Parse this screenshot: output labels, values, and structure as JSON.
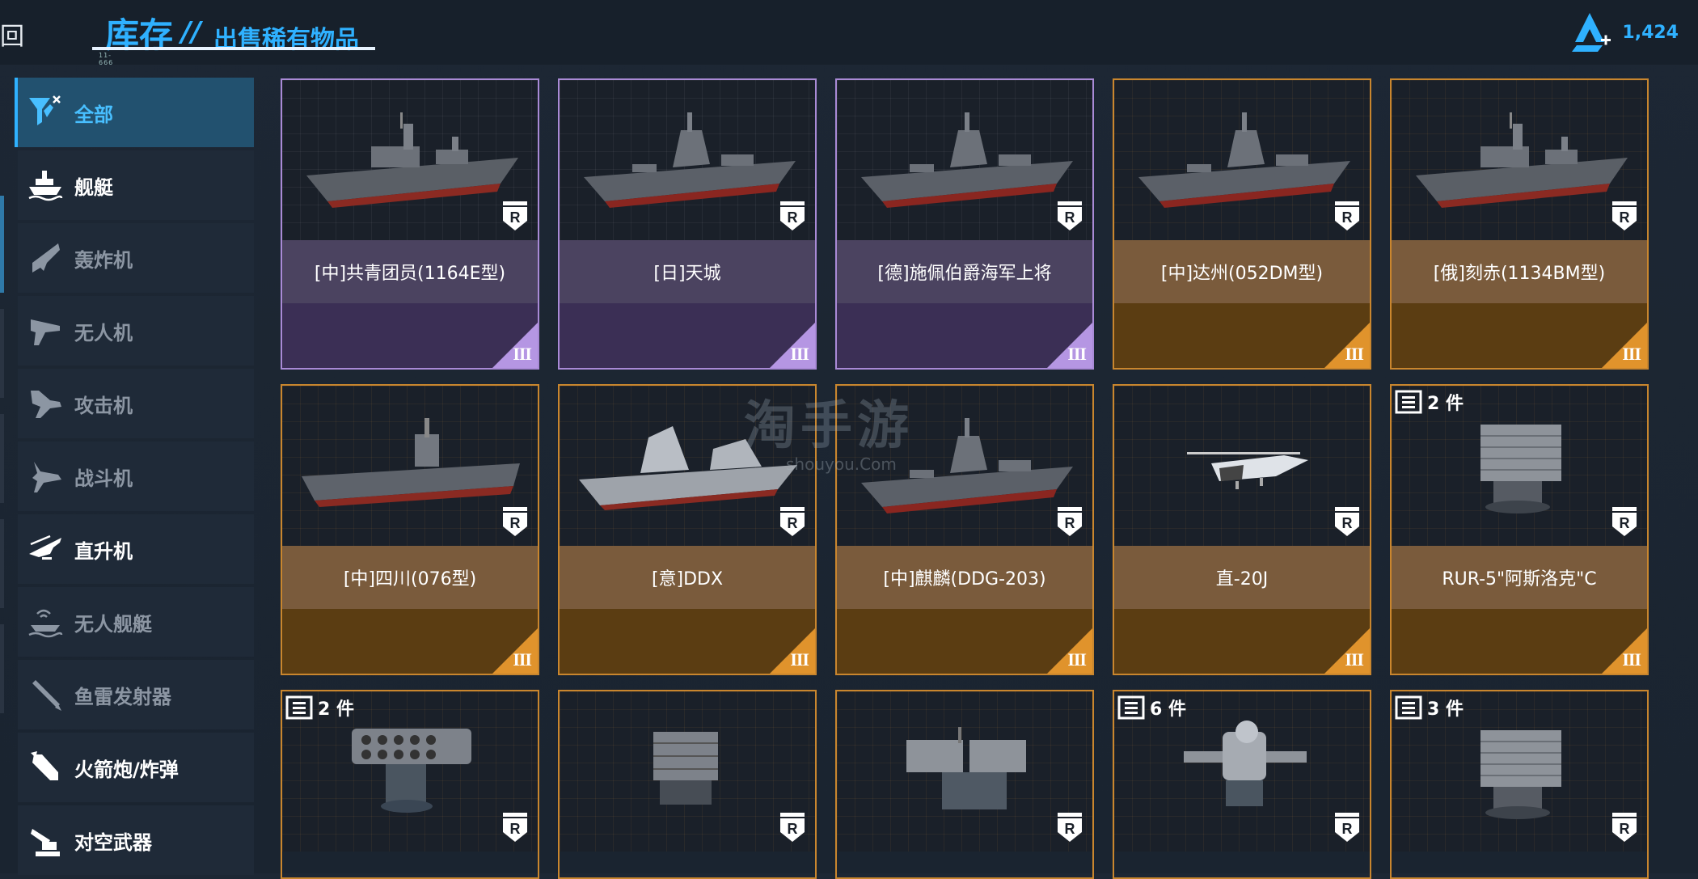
{
  "header": {
    "back_label": "回",
    "title": "库存",
    "separator": "//",
    "subtitle": "出售稀有物品",
    "tiny_text": "11-666",
    "currency_value": "1,424",
    "currency_icon": "credit-icon"
  },
  "sidebar": {
    "items": [
      {
        "label": "全部",
        "icon": "all-filter-icon",
        "state": "active"
      },
      {
        "label": "舰艇",
        "icon": "ship-icon",
        "state": "normal"
      },
      {
        "label": "轰炸机",
        "icon": "bomber-icon",
        "state": "dim"
      },
      {
        "label": "无人机",
        "icon": "drone-icon",
        "state": "dim"
      },
      {
        "label": "攻击机",
        "icon": "attack-aircraft-icon",
        "state": "dim"
      },
      {
        "label": "战斗机",
        "icon": "fighter-icon",
        "state": "dim"
      },
      {
        "label": "直升机",
        "icon": "helicopter-icon",
        "state": "normal"
      },
      {
        "label": "无人舰艇",
        "icon": "unmanned-boat-icon",
        "state": "dim"
      },
      {
        "label": "鱼雷发射器",
        "icon": "torpedo-launcher-icon",
        "state": "dim"
      },
      {
        "label": "火箭炮/炸弹",
        "icon": "rocket-bomb-icon",
        "state": "normal"
      },
      {
        "label": "对空武器",
        "icon": "anti-air-icon",
        "state": "normal"
      }
    ]
  },
  "items": [
    {
      "name": "[中]共青团员(1164E型)",
      "rarity": "purple",
      "tier": "III",
      "badge": "R",
      "model": "cruiser"
    },
    {
      "name": "[日]天城",
      "rarity": "purple",
      "tier": "III",
      "badge": "R",
      "model": "destroyer"
    },
    {
      "name": "[德]施佩伯爵海军上将",
      "rarity": "purple",
      "tier": "III",
      "badge": "R",
      "model": "destroyer"
    },
    {
      "name": "[中]达州(052DM型)",
      "rarity": "orange",
      "tier": "III",
      "badge": "R",
      "model": "destroyer"
    },
    {
      "name": "[俄]刻赤(1134BM型)",
      "rarity": "orange",
      "tier": "III",
      "badge": "R",
      "model": "cruiser"
    },
    {
      "name": "[中]四川(076型)",
      "rarity": "orange",
      "tier": "III",
      "badge": "R",
      "model": "carrier"
    },
    {
      "name": "[意]DDX",
      "rarity": "orange",
      "tier": "III",
      "badge": "R",
      "model": "stealth"
    },
    {
      "name": "[中]麒麟(DDG-203)",
      "rarity": "orange",
      "tier": "III",
      "badge": "R",
      "model": "destroyer"
    },
    {
      "name": "直-20J",
      "rarity": "orange",
      "tier": "III",
      "badge": "R",
      "model": "helicopter"
    },
    {
      "name": "RUR-5\"阿斯洛克\"C",
      "rarity": "orange",
      "tier": "III",
      "badge": "R",
      "model": "launcher-box",
      "qty": "2 件"
    },
    {
      "name": "",
      "rarity": "orange",
      "badge": "R",
      "model": "rocket-pod",
      "qty": "2 件"
    },
    {
      "name": "",
      "rarity": "orange",
      "badge": "R",
      "model": "launcher-small"
    },
    {
      "name": "",
      "rarity": "orange",
      "badge": "R",
      "model": "twin-launcher"
    },
    {
      "name": "",
      "rarity": "orange",
      "badge": "R",
      "model": "ciws",
      "qty": "6 件"
    },
    {
      "name": "",
      "rarity": "orange",
      "badge": "R",
      "model": "launcher-box",
      "qty": "3 件"
    }
  ],
  "watermark": {
    "text": "淘手游",
    "sub": "shouyou.Com"
  },
  "colors": {
    "accent": "#2fb1ff",
    "purple": "#a98ad6",
    "orange": "#c9862e"
  }
}
